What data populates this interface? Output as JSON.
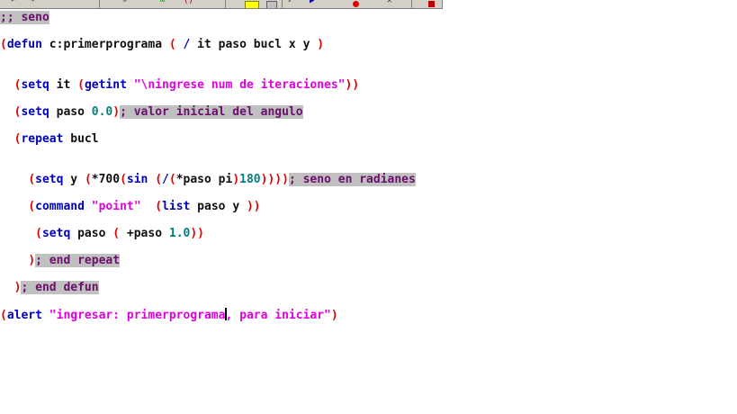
{
  "toolbar": {
    "buttons": [
      "undo-icon",
      "redo-icon",
      "find-icon",
      "replace-icon",
      "parens-icon",
      "color-icon",
      "format-icon",
      "check-icon",
      "run-icon",
      "stop-icon",
      "breakpoint-icon"
    ]
  },
  "editor": {
    "lines": [
      {
        "tokens": [
          {
            "c": "c",
            "v": ";; seno"
          }
        ]
      },
      {
        "tokens": [
          {
            "c": "p",
            "v": "("
          },
          {
            "c": "k",
            "v": "defun"
          },
          {
            "c": "t",
            "v": " c:primerprograma "
          },
          {
            "c": "p",
            "v": "("
          },
          {
            "c": "t",
            "v": " "
          },
          {
            "c": "k",
            "v": "/"
          },
          {
            "c": "t",
            "v": " it paso bucl x y "
          },
          {
            "c": "p",
            "v": ")"
          }
        ]
      },
      {
        "tokens": [
          {
            "c": "t",
            "v": "  "
          },
          {
            "c": "p",
            "v": "("
          },
          {
            "c": "k",
            "v": "setq"
          },
          {
            "c": "t",
            "v": " it "
          },
          {
            "c": "p",
            "v": "("
          },
          {
            "c": "k",
            "v": "getint"
          },
          {
            "c": "t",
            "v": " "
          },
          {
            "c": "s",
            "v": "\"\\ningrese num de iteraciones\""
          },
          {
            "c": "p",
            "v": "))"
          }
        ]
      },
      {
        "tokens": [
          {
            "c": "t",
            "v": "  "
          },
          {
            "c": "p",
            "v": "("
          },
          {
            "c": "k",
            "v": "setq"
          },
          {
            "c": "t",
            "v": " paso "
          },
          {
            "c": "n",
            "v": "0.0"
          },
          {
            "c": "p",
            "v": ")"
          },
          {
            "c": "c",
            "v": "; valor inicial del angulo"
          }
        ]
      },
      {
        "tokens": [
          {
            "c": "t",
            "v": "  "
          },
          {
            "c": "p",
            "v": "("
          },
          {
            "c": "k",
            "v": "repeat"
          },
          {
            "c": "t",
            "v": " bucl"
          }
        ]
      },
      {
        "tokens": [
          {
            "c": "t",
            "v": "    "
          },
          {
            "c": "p",
            "v": "("
          },
          {
            "c": "k",
            "v": "setq"
          },
          {
            "c": "t",
            "v": " y "
          },
          {
            "c": "p",
            "v": "("
          },
          {
            "c": "t",
            "v": "*700"
          },
          {
            "c": "p",
            "v": "("
          },
          {
            "c": "k",
            "v": "sin"
          },
          {
            "c": "t",
            "v": " "
          },
          {
            "c": "p",
            "v": "("
          },
          {
            "c": "k",
            "v": "/"
          },
          {
            "c": "p",
            "v": "("
          },
          {
            "c": "t",
            "v": "*paso pi"
          },
          {
            "c": "p",
            "v": ")"
          },
          {
            "c": "n",
            "v": "180"
          },
          {
            "c": "p",
            "v": "))))"
          },
          {
            "c": "c",
            "v": "; seno en radianes"
          }
        ]
      },
      {
        "tokens": [
          {
            "c": "t",
            "v": "    "
          },
          {
            "c": "p",
            "v": "("
          },
          {
            "c": "k",
            "v": "command"
          },
          {
            "c": "t",
            "v": " "
          },
          {
            "c": "s",
            "v": "\"point\""
          },
          {
            "c": "t",
            "v": "  "
          },
          {
            "c": "p",
            "v": "("
          },
          {
            "c": "k",
            "v": "list"
          },
          {
            "c": "t",
            "v": " paso y "
          },
          {
            "c": "p",
            "v": "))"
          }
        ]
      },
      {
        "tokens": [
          {
            "c": "t",
            "v": "     "
          },
          {
            "c": "p",
            "v": "("
          },
          {
            "c": "k",
            "v": "setq"
          },
          {
            "c": "t",
            "v": " paso "
          },
          {
            "c": "p",
            "v": "("
          },
          {
            "c": "t",
            "v": " +paso "
          },
          {
            "c": "n",
            "v": "1.0"
          },
          {
            "c": "p",
            "v": "))"
          }
        ]
      },
      {
        "tokens": [
          {
            "c": "t",
            "v": "    "
          },
          {
            "c": "p",
            "v": ")"
          },
          {
            "c": "c",
            "v": "; end repeat"
          }
        ]
      },
      {
        "tokens": [
          {
            "c": "t",
            "v": "  "
          },
          {
            "c": "p",
            "v": ")"
          },
          {
            "c": "c",
            "v": "; end defun"
          }
        ]
      },
      {
        "tokens": [
          {
            "c": "p",
            "v": "("
          },
          {
            "c": "k",
            "v": "alert"
          },
          {
            "c": "t",
            "v": " "
          },
          {
            "c": "s",
            "v": "\"ingresar: primerprograma"
          },
          {
            "c": "caret",
            "v": ""
          },
          {
            "c": "s",
            "v": ", para iniciar\""
          },
          {
            "c": "p",
            "v": ")"
          }
        ]
      }
    ]
  }
}
